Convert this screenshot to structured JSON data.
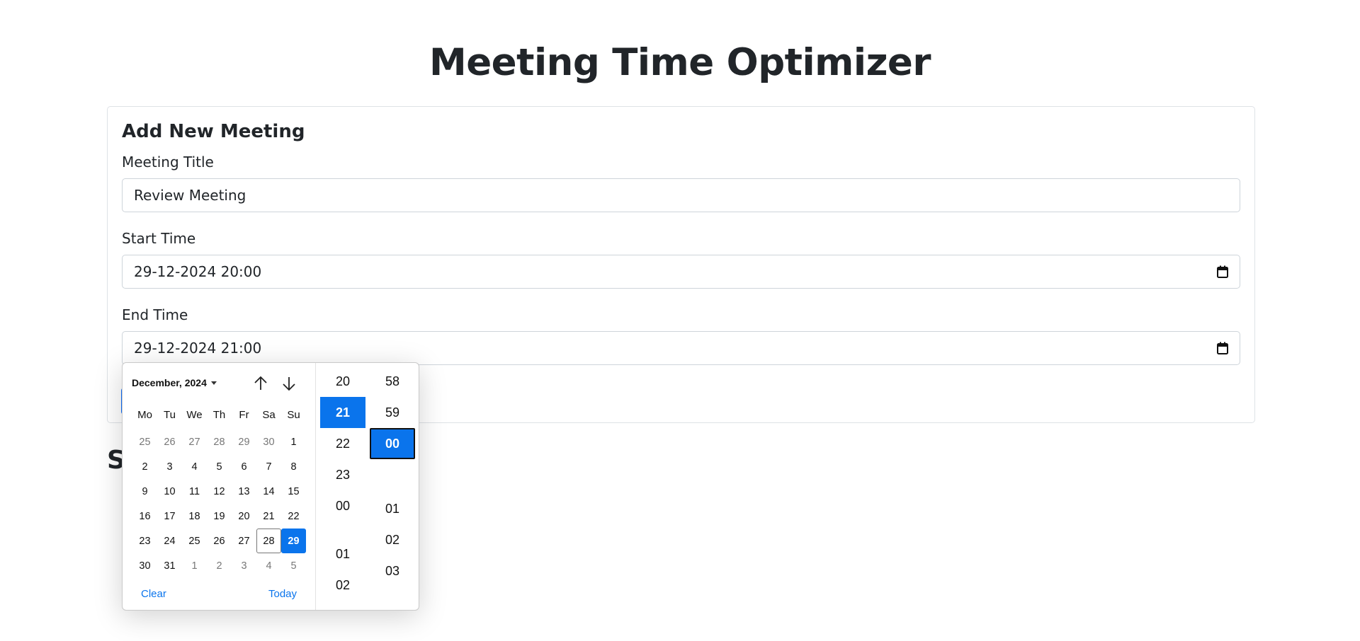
{
  "page": {
    "title": "Meeting Time Optimizer"
  },
  "form": {
    "heading": "Add New Meeting",
    "title_label": "Meeting Title",
    "title_value": "Review Meeting",
    "start_label": "Start Time",
    "start_value": "29-12-2024 20:00",
    "end_label": "End Time",
    "end_value": "29-12-2024 21:00"
  },
  "section_heading": "S",
  "picker": {
    "month_label": "December, 2024",
    "weekdays": [
      "Mo",
      "Tu",
      "We",
      "Th",
      "Fr",
      "Sa",
      "Su"
    ],
    "days": [
      {
        "d": "25",
        "other": true
      },
      {
        "d": "26",
        "other": true
      },
      {
        "d": "27",
        "other": true
      },
      {
        "d": "28",
        "other": true
      },
      {
        "d": "29",
        "other": true
      },
      {
        "d": "30",
        "other": true
      },
      {
        "d": "1"
      },
      {
        "d": "2"
      },
      {
        "d": "3"
      },
      {
        "d": "4"
      },
      {
        "d": "5"
      },
      {
        "d": "6"
      },
      {
        "d": "7"
      },
      {
        "d": "8"
      },
      {
        "d": "9"
      },
      {
        "d": "10"
      },
      {
        "d": "11"
      },
      {
        "d": "12"
      },
      {
        "d": "13"
      },
      {
        "d": "14"
      },
      {
        "d": "15"
      },
      {
        "d": "16"
      },
      {
        "d": "17"
      },
      {
        "d": "18"
      },
      {
        "d": "19"
      },
      {
        "d": "20"
      },
      {
        "d": "21"
      },
      {
        "d": "22"
      },
      {
        "d": "23"
      },
      {
        "d": "24"
      },
      {
        "d": "25"
      },
      {
        "d": "26"
      },
      {
        "d": "27"
      },
      {
        "d": "28",
        "today": true
      },
      {
        "d": "29",
        "selected": true
      },
      {
        "d": "30"
      },
      {
        "d": "31"
      },
      {
        "d": "1",
        "other": true
      },
      {
        "d": "2",
        "other": true
      },
      {
        "d": "3",
        "other": true
      },
      {
        "d": "4",
        "other": true
      },
      {
        "d": "5",
        "other": true
      }
    ],
    "clear_label": "Clear",
    "today_label": "Today",
    "hours": [
      "20",
      "21",
      "22",
      "23",
      "00",
      "01",
      "02"
    ],
    "selected_hour": "21",
    "minutes": [
      "58",
      "59",
      "00",
      "01",
      "02",
      "03"
    ],
    "selected_minute": "00",
    "accent_color": "#0a74ec"
  }
}
